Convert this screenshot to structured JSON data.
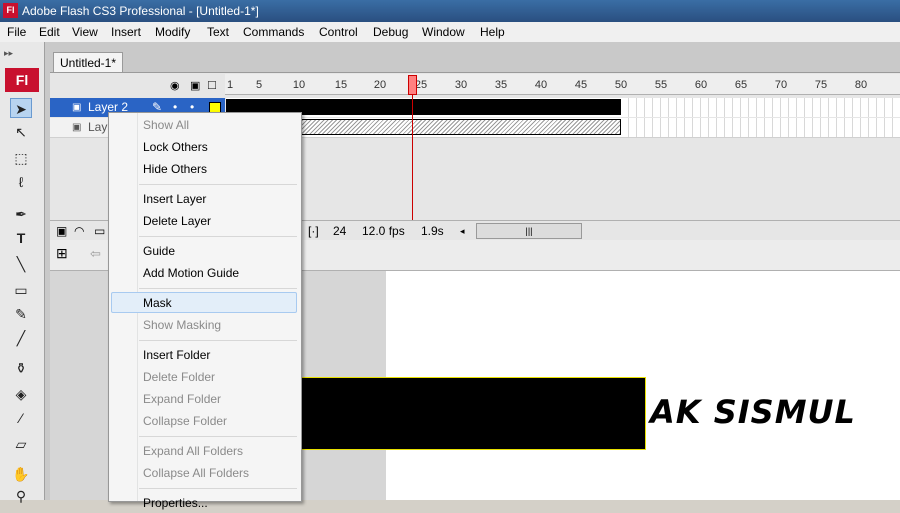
{
  "window": {
    "title": "Adobe Flash CS3 Professional - [Untitled-1*]",
    "app_icon": "Fl"
  },
  "menubar": [
    "File",
    "Edit",
    "View",
    "Insert",
    "Modify",
    "Text",
    "Commands",
    "Control",
    "Debug",
    "Window",
    "Help"
  ],
  "toolbox": {
    "logo": "Fl",
    "tools": [
      "selection-tool-icon",
      "subselection-tool-icon",
      "free-transform-icon",
      "lasso-icon",
      "pen-icon",
      "text-icon",
      "line-icon",
      "rectangle-icon",
      "pencil-icon",
      "brush-icon",
      "ink-bottle-icon",
      "paint-bucket-icon",
      "eyedropper-icon",
      "eraser-icon",
      "hand-icon",
      "zoom-icon"
    ]
  },
  "document": {
    "tab": "Untitled-1*"
  },
  "timeline": {
    "frame_numbers": [
      "1",
      "5",
      "10",
      "15",
      "20",
      "25",
      "30",
      "35",
      "40",
      "45",
      "50",
      "55",
      "60",
      "65",
      "70",
      "75",
      "80"
    ],
    "layers": [
      {
        "name": "Layer 2",
        "color": "#ffff00"
      },
      {
        "name": "Lay"
      }
    ],
    "status": {
      "current_frame": "24",
      "fps": "12.0 fps",
      "time": "1.9s"
    }
  },
  "stage": {
    "text": "AK SISMUL"
  },
  "context_menu": {
    "items": [
      {
        "label": "Show All",
        "enabled": false
      },
      {
        "label": "Lock Others",
        "enabled": true
      },
      {
        "label": "Hide Others",
        "enabled": true
      },
      {
        "label": "Insert Layer",
        "enabled": true
      },
      {
        "label": "Delete Layer",
        "enabled": true
      },
      {
        "label": "Guide",
        "enabled": true
      },
      {
        "label": "Add Motion Guide",
        "enabled": true
      },
      {
        "label": "Mask",
        "enabled": true
      },
      {
        "label": "Show Masking",
        "enabled": false
      },
      {
        "label": "Insert Folder",
        "enabled": true
      },
      {
        "label": "Delete Folder",
        "enabled": false
      },
      {
        "label": "Expand Folder",
        "enabled": false
      },
      {
        "label": "Collapse Folder",
        "enabled": false
      },
      {
        "label": "Expand All Folders",
        "enabled": false
      },
      {
        "label": "Collapse All Folders",
        "enabled": false
      },
      {
        "label": "Properties...",
        "enabled": true
      }
    ]
  }
}
